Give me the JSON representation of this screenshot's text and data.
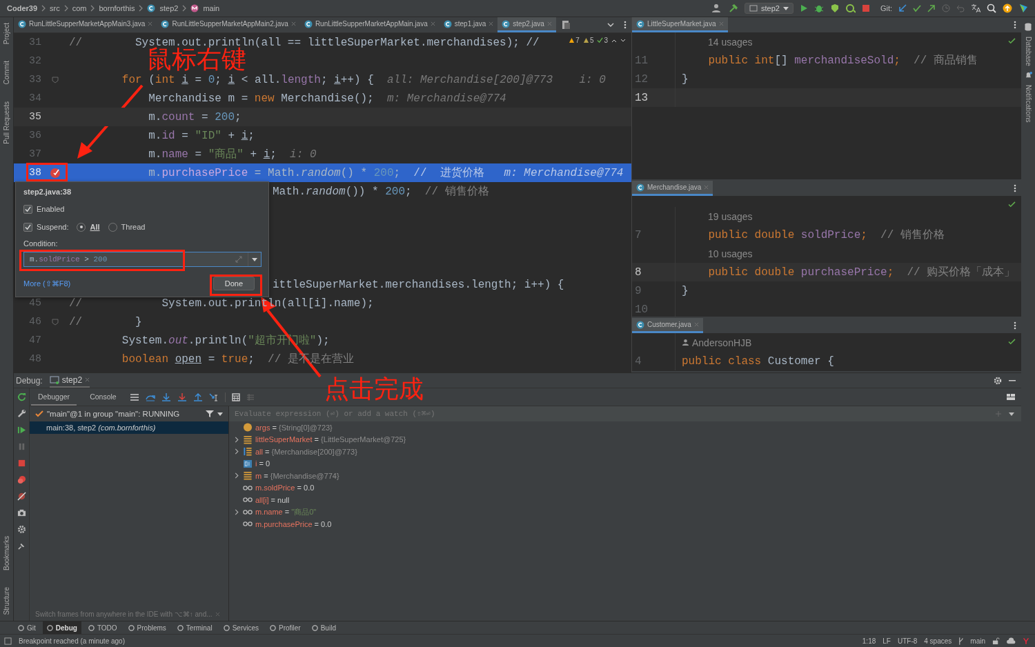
{
  "breadcrumbs": [
    {
      "text": "Coder39",
      "kind": "project"
    },
    {
      "text": "src",
      "kind": "folder"
    },
    {
      "text": "com",
      "kind": "folder"
    },
    {
      "text": "bornforthis",
      "kind": "folder"
    },
    {
      "text": "step2",
      "kind": "class"
    },
    {
      "text": "main",
      "kind": "method"
    }
  ],
  "run_config": "step2",
  "git_label": "Git:",
  "editor_tabs": [
    {
      "label": "RunLittleSupperMarketAppMain3.java",
      "selected": false
    },
    {
      "label": "RunLittleSupperMarketAppMain2.java",
      "selected": false
    },
    {
      "label": "RunLittleSupperMarketAppMain.java",
      "selected": false
    },
    {
      "label": "step1.java",
      "selected": false
    },
    {
      "label": "step2.java",
      "selected": true
    }
  ],
  "inspections": [
    {
      "kind": "warning",
      "count": "7"
    },
    {
      "kind": "weak",
      "count": "5"
    },
    {
      "kind": "ok",
      "count": "3"
    }
  ],
  "code_lines": [
    {
      "kind": "full",
      "number": "31",
      "current": false,
      "fold": false,
      "breakpoint": false,
      "tokens": [
        {
          "text": "//",
          "kind": "comment"
        },
        {
          "text": "        System.out.println(all == littleSuperMarket.merchandises); //",
          "kind": "plain"
        }
      ]
    },
    {
      "kind": "full",
      "number": "32",
      "current": false,
      "fold": false,
      "breakpoint": false
    },
    {
      "kind": "full",
      "number": "33",
      "current": false,
      "fold": true,
      "breakpoint": false,
      "tokens": [
        {
          "text": "        for",
          "kind": "keyword"
        },
        {
          "text": " (",
          "kind": "plain"
        },
        {
          "text": "int ",
          "kind": "keyword"
        },
        {
          "text": "i",
          "kind": "underline"
        },
        {
          "text": " = ",
          "kind": "plain"
        },
        {
          "text": "0",
          "kind": "number"
        },
        {
          "text": "; ",
          "kind": "plain"
        },
        {
          "text": "i",
          "kind": "underline"
        },
        {
          "text": " < all.",
          "kind": "plain"
        },
        {
          "text": "length",
          "kind": "field"
        },
        {
          "text": "; ",
          "kind": "plain"
        },
        {
          "text": "i",
          "kind": "underline"
        },
        {
          "text": "++) {",
          "kind": "plain"
        },
        {
          "text": "  all: Merchandise[200]@773    i: 0",
          "kind": "hint"
        }
      ]
    },
    {
      "kind": "full",
      "number": "34",
      "current": false,
      "fold": false,
      "breakpoint": false,
      "tokens": [
        {
          "text": "            Merchandise m = ",
          "kind": "plain"
        },
        {
          "text": "new",
          "kind": "keyword"
        },
        {
          "text": " Merchandise();",
          "kind": "plain"
        },
        {
          "text": "  m: Merchandise@774",
          "kind": "hint"
        }
      ]
    },
    {
      "kind": "full",
      "number": "35",
      "current": true,
      "fold": false,
      "breakpoint": false,
      "tokens": [
        {
          "text": "            m.",
          "kind": "plain"
        },
        {
          "text": "count",
          "kind": "field"
        },
        {
          "text": " = ",
          "kind": "plain"
        },
        {
          "text": "200",
          "kind": "number"
        },
        {
          "text": ";",
          "kind": "plain"
        }
      ]
    },
    {
      "kind": "full",
      "number": "36",
      "current": false,
      "fold": false,
      "breakpoint": false,
      "tokens": [
        {
          "text": "            m.",
          "kind": "plain"
        },
        {
          "text": "id",
          "kind": "field"
        },
        {
          "text": " = ",
          "kind": "plain"
        },
        {
          "text": "\"ID\"",
          "kind": "string"
        },
        {
          "text": " + ",
          "kind": "plain"
        },
        {
          "text": "i",
          "kind": "underline"
        },
        {
          "text": ";",
          "kind": "plain"
        }
      ]
    },
    {
      "kind": "full",
      "number": "37",
      "current": false,
      "fold": false,
      "breakpoint": false,
      "tokens": [
        {
          "text": "            m.",
          "kind": "plain"
        },
        {
          "text": "name",
          "kind": "field"
        },
        {
          "text": " = ",
          "kind": "plain"
        },
        {
          "text": "\"商品\"",
          "kind": "string"
        },
        {
          "text": " + ",
          "kind": "plain"
        },
        {
          "text": "i",
          "kind": "underline"
        },
        {
          "text": ";",
          "kind": "plain"
        },
        {
          "text": "  i: 0",
          "kind": "hint"
        }
      ]
    },
    {
      "kind": "full",
      "number": "38",
      "current": false,
      "execution_point": true,
      "fold": false,
      "breakpoint": true,
      "tokens": [
        {
          "text": "            m.",
          "kind": "plain"
        },
        {
          "text": "purchasePrice",
          "kind": "field"
        },
        {
          "text": " = Math.",
          "kind": "plain"
        },
        {
          "text": "random",
          "kind": "italic"
        },
        {
          "text": "() * ",
          "kind": "plain"
        },
        {
          "text": "200",
          "kind": "number"
        },
        {
          "text": ";  ",
          "kind": "plain"
        },
        {
          "text": "//  进货价格",
          "kind": "comment"
        },
        {
          "text": "   m: Merchandise@774",
          "kind": "hint"
        }
      ]
    },
    {
      "kind": "partial",
      "tokens": [
        {
          "text": "Math.",
          "kind": "plain"
        },
        {
          "text": "random",
          "kind": "italic"
        },
        {
          "text": "()) * ",
          "kind": "plain"
        },
        {
          "text": "200",
          "kind": "number"
        },
        {
          "text": ";  ",
          "kind": "plain"
        },
        {
          "text": "// 销售价格",
          "kind": "comment"
        }
      ]
    },
    {
      "kind": "blank"
    },
    {
      "kind": "blank"
    },
    {
      "kind": "blank"
    },
    {
      "kind": "blank"
    },
    {
      "kind": "partial",
      "tokens": [
        {
          "text": "ittleSuperMarket.merchandises.length; i++) {",
          "kind": "plain"
        }
      ]
    },
    {
      "kind": "full",
      "number": "45",
      "current": false,
      "fold": false,
      "breakpoint": false,
      "tokens": [
        {
          "text": "//",
          "kind": "comment"
        },
        {
          "text": "            System.out.println(all[i].name);",
          "kind": "plain"
        }
      ]
    },
    {
      "kind": "full",
      "number": "46",
      "current": false,
      "fold": true,
      "breakpoint": false,
      "tokens": [
        {
          "text": "//",
          "kind": "comment"
        },
        {
          "text": "        }",
          "kind": "plain"
        }
      ]
    },
    {
      "kind": "full",
      "number": "47",
      "current": false,
      "fold": false,
      "breakpoint": false,
      "tokens": [
        {
          "text": "        System.",
          "kind": "plain"
        },
        {
          "text": "out",
          "kind": "static_field"
        },
        {
          "text": ".println(",
          "kind": "plain"
        },
        {
          "text": "\"超市开门啦\"",
          "kind": "string"
        },
        {
          "text": ");",
          "kind": "plain"
        }
      ]
    },
    {
      "kind": "full",
      "number": "48",
      "current": false,
      "fold": false,
      "breakpoint": false,
      "tokens": [
        {
          "text": "        boolean ",
          "kind": "keyword"
        },
        {
          "text": "open",
          "kind": "underline"
        },
        {
          "text": " = ",
          "kind": "plain"
        },
        {
          "text": "true",
          "kind": "keyword"
        },
        {
          "text": ";  ",
          "kind": "plain"
        },
        {
          "text": "// 是不是在营业",
          "kind": "comment"
        }
      ]
    }
  ],
  "breakpoint_popup": {
    "title": "step2.java:38",
    "enabled": {
      "label": "Enabled",
      "checked": true
    },
    "suspend": {
      "label": "Suspend:",
      "checked": true
    },
    "suspend_options": [
      {
        "label": "All",
        "selected": true
      },
      {
        "label": "Thread",
        "selected": false
      }
    ],
    "condition_label": "Condition:",
    "condition": [
      {
        "text": "m.",
        "kind": "plain"
      },
      {
        "text": "soldPrice",
        "kind": "field"
      },
      {
        "text": " > ",
        "kind": "plain"
      },
      {
        "text": "200",
        "kind": "number"
      }
    ],
    "more_link": "More (⇧⌘F8)",
    "done": "Done"
  },
  "split_editors": [
    {
      "tab": "LittleSuperMarket.java",
      "lines": [
        {
          "kind": "usages",
          "text": "14 usages"
        },
        {
          "kind": "code",
          "number": "11",
          "current": false,
          "tokens": [
            {
              "text": "    public int",
              "kind": "keyword"
            },
            {
              "text": "[] ",
              "kind": "plain"
            },
            {
              "text": "merchandiseSold",
              "kind": "field"
            },
            {
              "text": ";",
              "kind": "keyword"
            },
            {
              "text": "  // 商品销售",
              "kind": "comment"
            }
          ]
        },
        {
          "kind": "code",
          "number": "12",
          "current": false,
          "tokens": [
            {
              "text": "}",
              "kind": "plain"
            }
          ]
        },
        {
          "kind": "code",
          "number": "13",
          "current": true
        }
      ]
    },
    {
      "tab": "Merchandise.java",
      "lines": [
        {
          "kind": "usages",
          "text": "19 usages"
        },
        {
          "kind": "code",
          "number": "7",
          "current": false,
          "tokens": [
            {
              "text": "    public double ",
              "kind": "keyword"
            },
            {
              "text": "soldPrice",
              "kind": "field"
            },
            {
              "text": ";",
              "kind": "keyword"
            },
            {
              "text": "  // 销售价格",
              "kind": "comment"
            }
          ]
        },
        {
          "kind": "usages",
          "text": "10 usages"
        },
        {
          "kind": "code",
          "number": "8",
          "current": true,
          "tokens": [
            {
              "text": "    public double ",
              "kind": "keyword"
            },
            {
              "text": "purchasePrice",
              "kind": "field"
            },
            {
              "text": ";",
              "kind": "keyword"
            },
            {
              "text": "  // 购买价格「成本」",
              "kind": "comment"
            }
          ]
        },
        {
          "kind": "code",
          "number": "9",
          "current": false,
          "tokens": [
            {
              "text": "}",
              "kind": "plain"
            }
          ]
        },
        {
          "kind": "code",
          "number": "10",
          "current": false
        }
      ]
    },
    {
      "tab": "Customer.java",
      "lines": [
        {
          "kind": "author",
          "text": "AndersonHJB"
        },
        {
          "kind": "code",
          "number": "4",
          "current": false,
          "tokens": [
            {
              "text": "public class",
              "kind": "keyword"
            },
            {
              "text": " Customer {",
              "kind": "plain"
            }
          ]
        }
      ]
    }
  ],
  "debug": {
    "title": "Debug:",
    "session_tab": "step2",
    "tabs": [
      {
        "label": "Debugger",
        "selected": true
      },
      {
        "label": "Console",
        "selected": false
      }
    ],
    "thread": "\"main\"@1 in group \"main\": RUNNING",
    "frames": [
      {
        "method": "main:38, step2",
        "package": "(com.bornforthis)",
        "selected": true
      }
    ],
    "hint": "Switch frames from anywhere in the IDE with ⌥⌘↑ and...",
    "evaluate_placeholder": "Evaluate expression (⏎) or add a watch (⇧⌘⏎)",
    "variables": [
      {
        "kind": "param",
        "name": "args",
        "operator": "=",
        "value": {
          "text": "{String[0]@723}",
          "kind": "ref"
        },
        "expandable": false
      },
      {
        "kind": "object",
        "name": "littleSuperMarket",
        "operator": "=",
        "value": {
          "text": "{LittleSuperMarket@725}",
          "kind": "ref"
        },
        "expandable": true
      },
      {
        "kind": "array",
        "name": "all",
        "operator": "=",
        "value": {
          "text": "{Merchandise[200]@773}",
          "kind": "ref"
        },
        "expandable": true
      },
      {
        "kind": "primitive",
        "name": "i",
        "operator": "=",
        "value": {
          "text": "0",
          "kind": "number"
        },
        "expandable": false
      },
      {
        "kind": "object",
        "name": "m",
        "operator": "=",
        "value": {
          "text": "{Merchandise@774}",
          "kind": "ref"
        },
        "expandable": true
      },
      {
        "kind": "watch",
        "name": "m.soldPrice",
        "operator": "=",
        "value": {
          "text": "0.0",
          "kind": "number"
        },
        "expandable": false
      },
      {
        "kind": "watch",
        "name": "all[i]",
        "operator": "=",
        "value": {
          "text": "null",
          "kind": "number"
        },
        "expandable": false
      },
      {
        "kind": "watch",
        "name": "m.name",
        "operator": "=",
        "value": {
          "text": "\"商品0\"",
          "kind": "string"
        },
        "expandable": true
      },
      {
        "kind": "watch",
        "name": "m.purchasePrice",
        "operator": "=",
        "value": {
          "text": "0.0",
          "kind": "number"
        },
        "expandable": false
      }
    ]
  },
  "bottom_tools": [
    {
      "label": "Git",
      "selected": false
    },
    {
      "label": "Debug",
      "selected": true
    },
    {
      "label": "TODO",
      "selected": false
    },
    {
      "label": "Problems",
      "selected": false
    },
    {
      "label": "Terminal",
      "selected": false
    },
    {
      "label": "Services",
      "selected": false
    },
    {
      "label": "Profiler",
      "selected": false
    },
    {
      "label": "Build",
      "selected": false
    }
  ],
  "status": {
    "message": "Breakpoint reached (a minute ago)",
    "position": "1:18",
    "line_ending": "LF",
    "encoding": "UTF-8",
    "indent": "4 spaces",
    "branch": "main"
  },
  "tool_strips": {
    "left_top": [
      "Project",
      "Commit",
      "Pull Requests"
    ],
    "left_bottom": [
      "Bookmarks",
      "Structure"
    ],
    "right": [
      "Database",
      "Notifications"
    ]
  },
  "annotations": [
    {
      "text": "鼠标右键"
    },
    {
      "text": "点击完成"
    }
  ]
}
